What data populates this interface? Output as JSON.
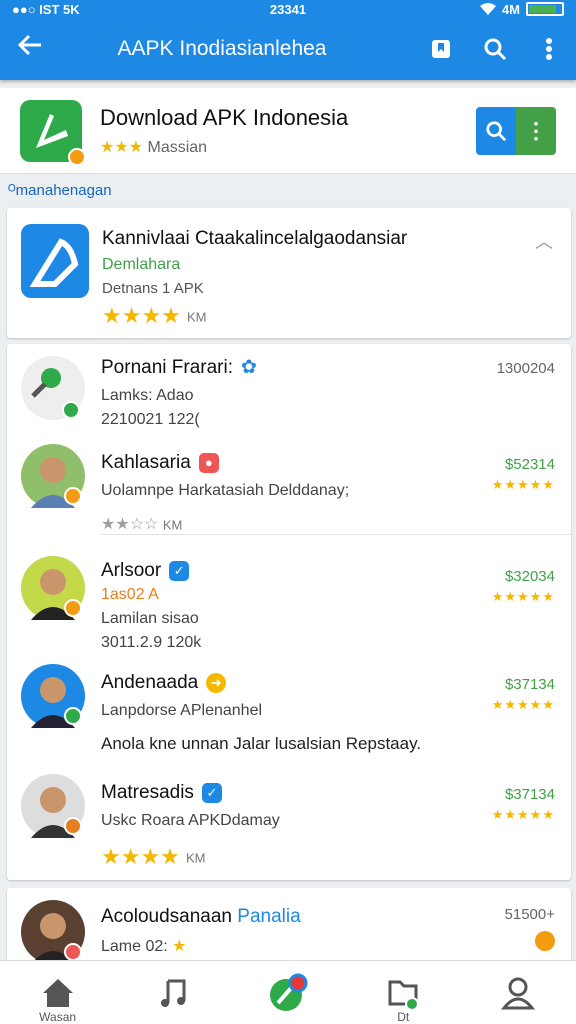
{
  "status_bar": {
    "left": "●●○ IST 5K",
    "center": "23341",
    "right": "4M"
  },
  "app_bar": {
    "title": "AAPK Inodiasianlehea",
    "back_icon": "arrow-left-icon",
    "actions": [
      "bookmark-icon",
      "search-icon",
      "more-vertical-icon"
    ]
  },
  "colors": {
    "primary": "#1e88e5",
    "accent_green": "#43a047",
    "star": "#f5b800"
  },
  "header": {
    "app_name": "Download APK Indonesia",
    "stars": "★★★",
    "subtitle": "Massian",
    "search_icon": "search-icon",
    "menu_glyph": "⋮"
  },
  "section_label": "ᴼmanahenagan",
  "featured": {
    "title": "Kannivlaai Ctaakalincelalgaodansiar",
    "subtitle": "Demlahara",
    "meta": "Detnans 1 APK",
    "stars": "★★★★",
    "stars_suffix": "KM",
    "rating": 4
  },
  "list": [
    {
      "name": "Pornani Frarari:",
      "line2": "Lamks: Adao",
      "line3": "2210021 122(",
      "right_top": "1300204",
      "right_stars": ""
    },
    {
      "name": "Kahlasaria",
      "line2": "Uolamnpe Harkatasiah Delddanay;",
      "line3_stars": "★★☆☆",
      "line3_suffix": "KM",
      "right_top": "$52314",
      "right_stars": "★★★★★"
    },
    {
      "name": "Arlsoor",
      "line2": "1as02 A",
      "line3": "Lamilan sisao",
      "line4": "3011.2.9 120k",
      "right_top": "$32034",
      "right_stars": "★★★★★"
    },
    {
      "name": "Andenaada",
      "line2": "Lanpdorse APlenanhel",
      "line3": "Anola kne unnan Jalar lusalsian Repstaay.",
      "right_top": "$37134",
      "right_stars": "★★★★★"
    },
    {
      "name": "Matresadis",
      "line2": "Uskc Roara APKDdamay",
      "line3_stars": "★★★★",
      "line3_suffix": "KM",
      "right_top": "$37134",
      "right_stars": "★★★★★"
    }
  ],
  "last_card": {
    "name": "Acoloudsanaan",
    "name_accent": "Panalia",
    "line2": "Lame 02:",
    "right_top": "51500+"
  },
  "bottom_nav": [
    {
      "icon": "home-icon",
      "label": "Wasan"
    },
    {
      "icon": "music-note-icon",
      "label": ""
    },
    {
      "icon": "app-center-icon",
      "label": ""
    },
    {
      "icon": "folder-icon",
      "label": "Dt"
    },
    {
      "icon": "profile-icon",
      "label": ""
    }
  ]
}
